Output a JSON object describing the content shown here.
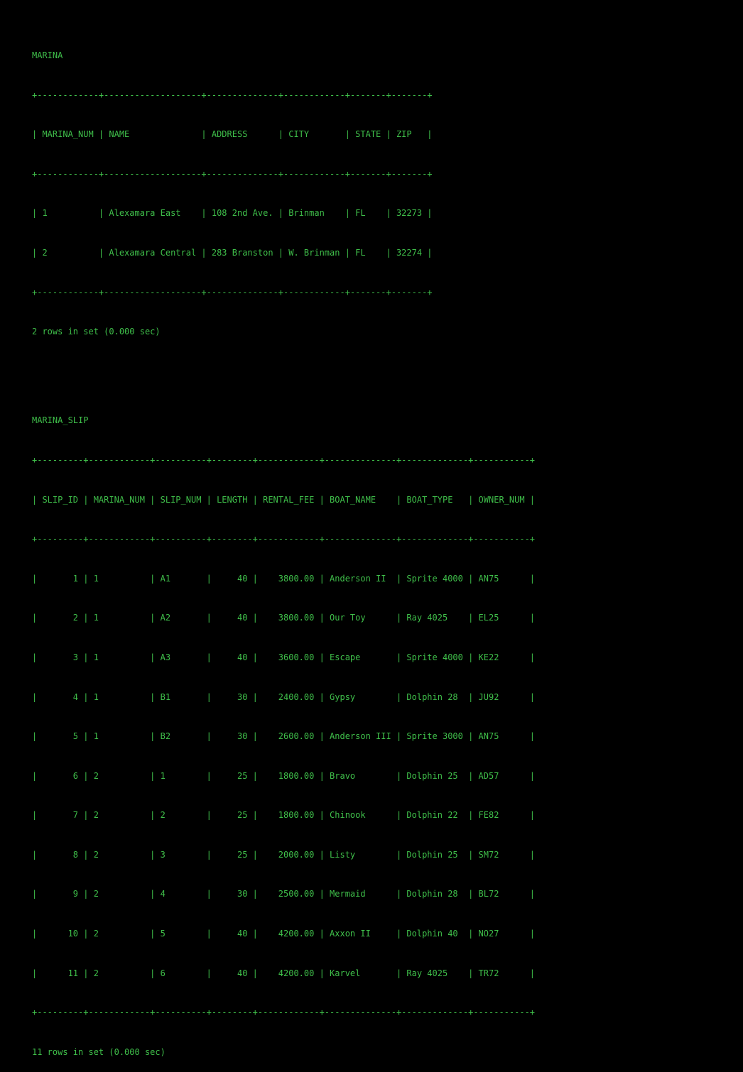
{
  "terminal": {
    "text_color": "#3fbf4a",
    "background": "#000000"
  },
  "marina": {
    "title": "MARINA",
    "border": "+------------+-------------------+--------------+------------+-------+-------+",
    "header": "| MARINA_NUM | NAME              | ADDRESS      | CITY       | STATE | ZIP   |",
    "rows": [
      "| 1          | Alexamara East    | 108 2nd Ave. | Brinman    | FL    | 32273 |",
      "| 2          | Alexamara Central | 283 Branston | W. Brinman | FL    | 32274 |"
    ],
    "footer": "2 rows in set (0.000 sec)"
  },
  "marina_slip": {
    "title": "MARINA_SLIP",
    "border": "+---------+------------+----------+--------+------------+--------------+-------------+-----------+",
    "header": "| SLIP_ID | MARINA_NUM | SLIP_NUM | LENGTH | RENTAL_FEE | BOAT_NAME    | BOAT_TYPE   | OWNER_NUM |",
    "rows": [
      "|       1 | 1          | A1       |     40 |    3800.00 | Anderson II  | Sprite 4000 | AN75      |",
      "|       2 | 1          | A2       |     40 |    3800.00 | Our Toy      | Ray 4025    | EL25      |",
      "|       3 | 1          | A3       |     40 |    3600.00 | Escape       | Sprite 4000 | KE22      |",
      "|       4 | 1          | B1       |     30 |    2400.00 | Gypsy        | Dolphin 28  | JU92      |",
      "|       5 | 1          | B2       |     30 |    2600.00 | Anderson III | Sprite 3000 | AN75      |",
      "|       6 | 2          | 1        |     25 |    1800.00 | Bravo        | Dolphin 25  | AD57      |",
      "|       7 | 2          | 2        |     25 |    1800.00 | Chinook      | Dolphin 22  | FE82      |",
      "|       8 | 2          | 3        |     25 |    2000.00 | Listy        | Dolphin 25  | SM72      |",
      "|       9 | 2          | 4        |     30 |    2500.00 | Mermaid      | Dolphin 28  | BL72      |",
      "|      10 | 2          | 5        |     40 |    4200.00 | Axxon II     | Dolphin 40  | NO27      |",
      "|      11 | 2          | 6        |     40 |    4200.00 | Karvel       | Ray 4025    | TR72      |"
    ],
    "footer": "11 rows in set (0.000 sec)"
  }
}
